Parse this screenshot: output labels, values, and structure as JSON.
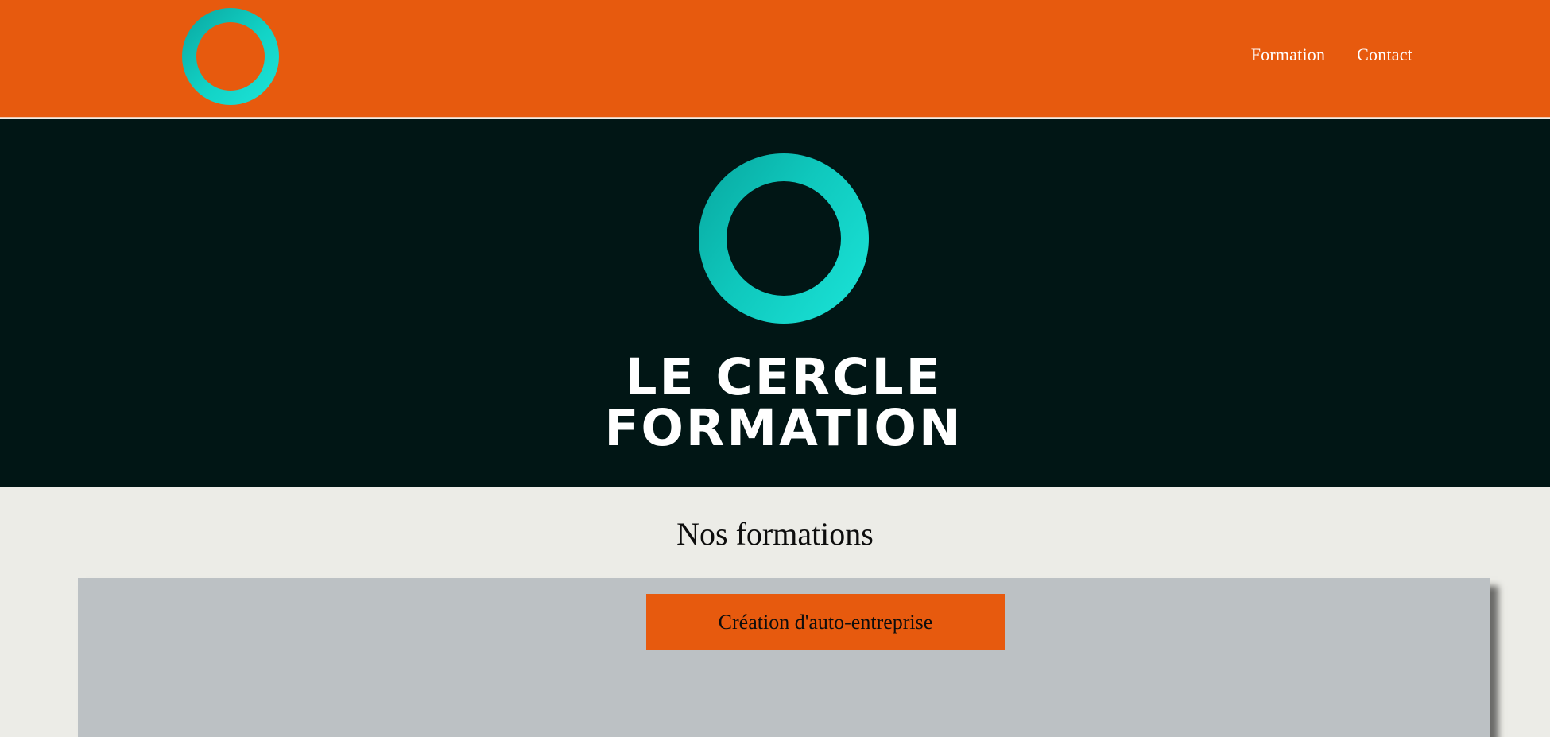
{
  "header": {
    "logo_icon": "ring-logo-icon",
    "nav": [
      {
        "label": "Formation"
      },
      {
        "label": "Contact"
      }
    ]
  },
  "hero": {
    "logo_icon": "ring-logo-icon",
    "wordmark_line1": "LE CERCLE",
    "wordmark_line2": "FORMATION"
  },
  "section": {
    "title": "Nos formations",
    "course_button_label": "Création d'auto-entreprise"
  },
  "colors": {
    "brand_orange": "#e75a0e",
    "hero_background": "#011615",
    "ring_teal": "#12d3c6",
    "page_background": "#ecece7",
    "panel_grey": "#bcc1c4"
  }
}
